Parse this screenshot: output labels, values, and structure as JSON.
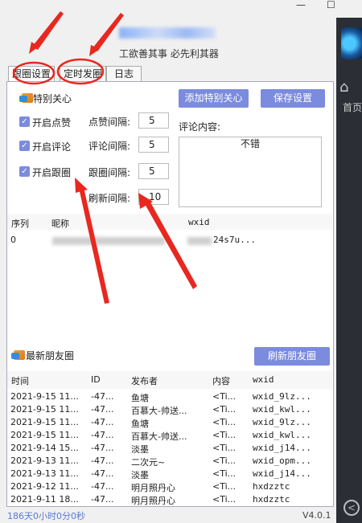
{
  "window": {
    "minimize": "—",
    "maximize": "☐",
    "subtitle": "工欲善其事 必先利其器"
  },
  "sidebar": {
    "home_label": "首页"
  },
  "tabs": [
    "跟圈设置",
    "定时发圈",
    "日志"
  ],
  "special": {
    "section_title": "特别关心",
    "add_button": "添加特别关心",
    "save_button": "保存设置"
  },
  "settings": {
    "like_toggle": "开启点赞",
    "comment_toggle": "开启评论",
    "follow_toggle": "开启跟圈",
    "like_interval_label": "点赞间隔:",
    "like_interval": "5",
    "comment_interval_label": "评论间隔:",
    "comment_interval": "5",
    "follow_interval_label": "跟圈间隔:",
    "follow_interval": "5",
    "refresh_interval_label": "刷新间隔:",
    "refresh_interval": "10",
    "comment_content_label": "评论内容:",
    "comment_content": "不错"
  },
  "special_table": {
    "headers": [
      "序列",
      "昵称",
      "wxid"
    ],
    "rows": [
      {
        "index": "0",
        "nickname": "",
        "wxid": "24s7u..."
      }
    ]
  },
  "moments": {
    "section_title": "最新朋友圈",
    "refresh_button": "刷新朋友圈",
    "headers": [
      "时间",
      "ID",
      "发布者",
      "内容",
      "wxid"
    ],
    "rows": [
      {
        "time": "2021-9-15 11...",
        "id": "-47...",
        "author": "鱼塘",
        "content": "<Ti...",
        "wxid": "wxid_9lz..."
      },
      {
        "time": "2021-9-15 11...",
        "id": "-47...",
        "author": "百慕大-帅送...",
        "content": "<Ti...",
        "wxid": "wxid_kwl..."
      },
      {
        "time": "2021-9-15 11...",
        "id": "-47...",
        "author": "鱼塘",
        "content": "<Ti...",
        "wxid": "wxid_9lz..."
      },
      {
        "time": "2021-9-15 11...",
        "id": "-47...",
        "author": "百慕大-帅送...",
        "content": "<Ti...",
        "wxid": "wxid_kwl..."
      },
      {
        "time": "2021-9-14 15...",
        "id": "-47...",
        "author": "淡墨",
        "content": "<Ti...",
        "wxid": "wxid_j14..."
      },
      {
        "time": "2021-9-13 11...",
        "id": "-47...",
        "author": "二次元~",
        "content": "<Ti...",
        "wxid": "wxid_opm..."
      },
      {
        "time": "2021-9-13 11...",
        "id": "-47...",
        "author": "淡墨",
        "content": "<Ti...",
        "wxid": "wxid_j14..."
      },
      {
        "time": "2021-9-12 11...",
        "id": "-47...",
        "author": "明月照丹心",
        "content": "<Ti...",
        "wxid": "hxdzztc"
      },
      {
        "time": "2021-9-11 18...",
        "id": "-47...",
        "author": "明月照丹心",
        "content": "<Ti...",
        "wxid": "hxdzztc"
      }
    ]
  },
  "status": {
    "uptime": "186天0小时0分0秒",
    "version": "V4.0.1"
  },
  "colors": {
    "accent": "#7b8bde",
    "annotation": "#e8281f",
    "sidebar": "#2b2f35"
  }
}
